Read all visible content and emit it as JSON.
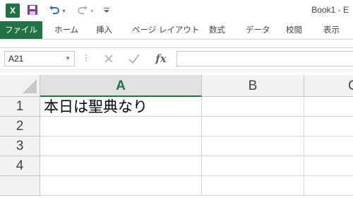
{
  "window": {
    "title": "Book1 - E"
  },
  "quick_access": {
    "logo_letter": "X",
    "icons": [
      "excel-logo-icon",
      "save-icon",
      "undo-icon",
      "redo-icon",
      "customize-icon"
    ]
  },
  "ribbon": {
    "file_tab": "ファイル",
    "tabs": [
      "ホーム",
      "挿入",
      "ページ レイアウト",
      "数式",
      "データ",
      "校閲",
      "表示"
    ]
  },
  "formula_bar": {
    "name_box": "A21",
    "fx_label": "fx",
    "formula": ""
  },
  "sheet": {
    "columns": [
      "A",
      "B",
      "C"
    ],
    "selected_column": "A",
    "rows": [
      "1",
      "2",
      "3",
      "4"
    ],
    "cells": {
      "A1": "本日は聖典なり"
    }
  },
  "colors": {
    "accent": "#217346",
    "header_bg": "#f2f2f2"
  }
}
